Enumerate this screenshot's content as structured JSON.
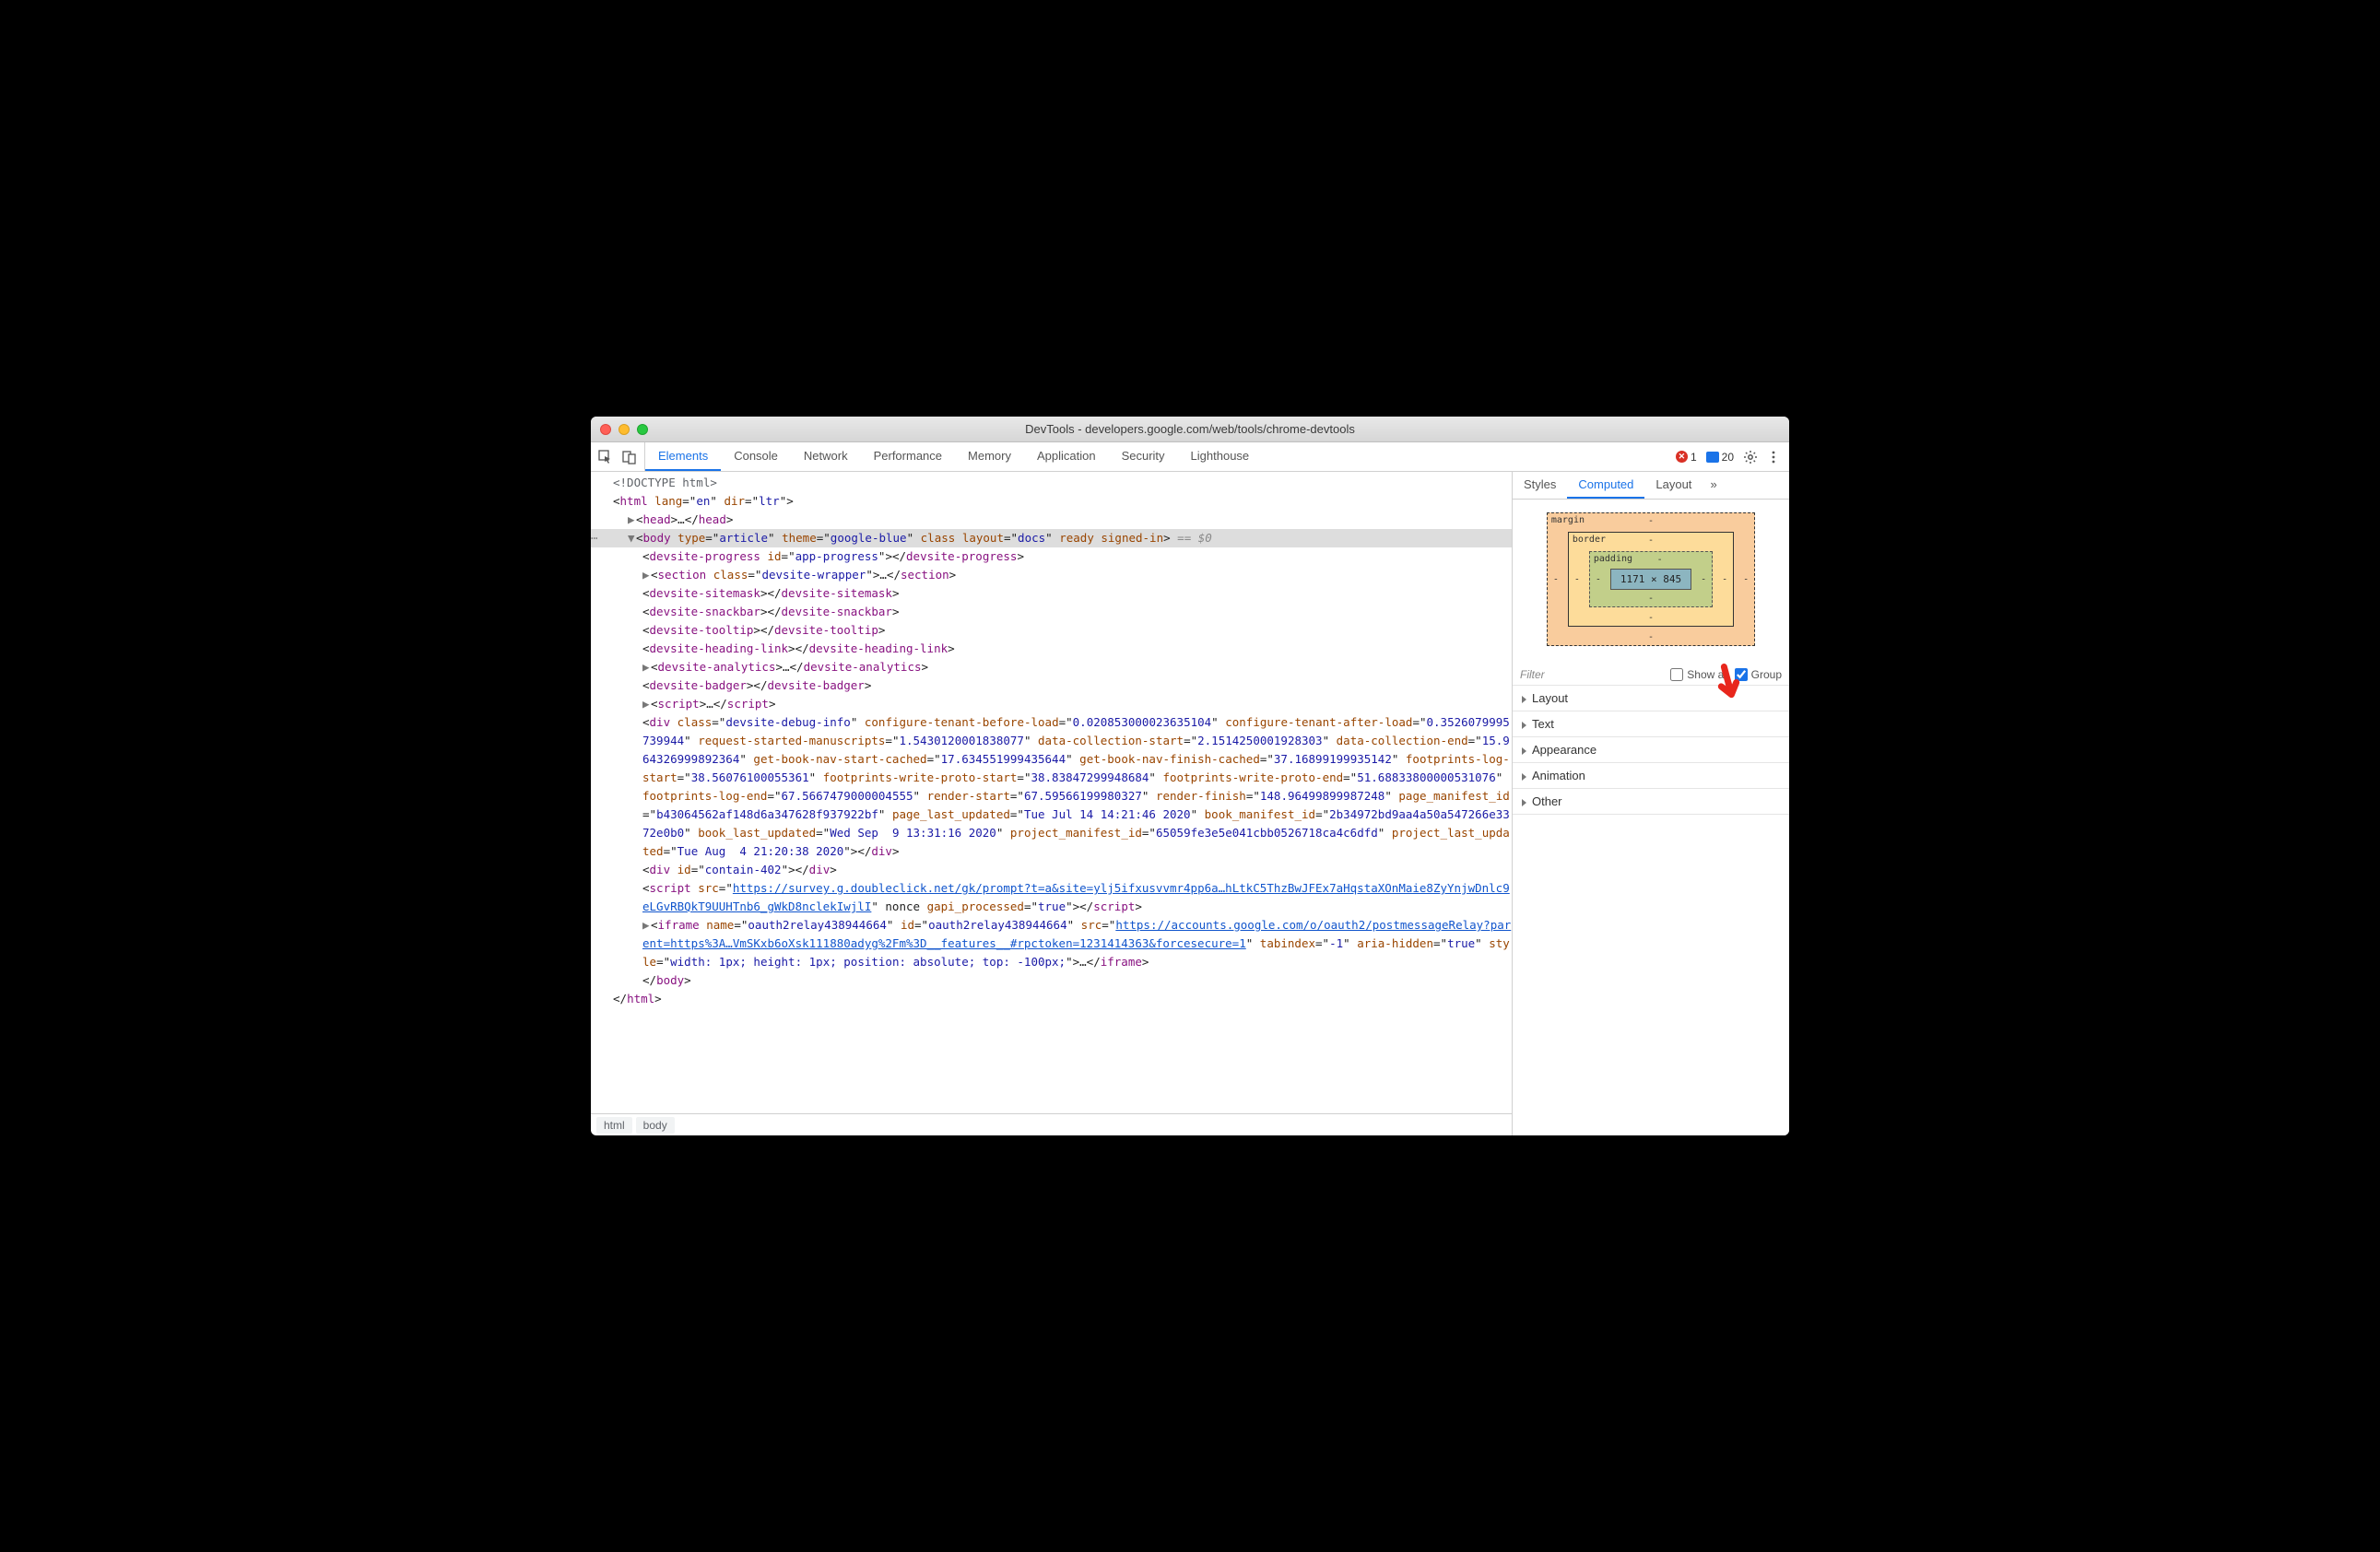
{
  "window": {
    "title": "DevTools - developers.google.com/web/tools/chrome-devtools"
  },
  "toolbar": {
    "tabs": [
      "Elements",
      "Console",
      "Network",
      "Performance",
      "Memory",
      "Application",
      "Security",
      "Lighthouse"
    ],
    "active_tab": "Elements",
    "errors": "1",
    "messages": "20"
  },
  "side": {
    "tabs": [
      "Styles",
      "Computed",
      "Layout"
    ],
    "active_tab": "Computed",
    "box_model": {
      "margin_label": "margin",
      "border_label": "border",
      "padding_label": "padding",
      "content_size": "1171 × 845",
      "dash": "-"
    },
    "filter_placeholder": "Filter",
    "show_all_label": "Show all",
    "show_all_checked": false,
    "group_label": "Group",
    "group_checked": true,
    "sections": [
      "Layout",
      "Text",
      "Appearance",
      "Animation",
      "Other"
    ]
  },
  "breadcrumbs": [
    "html",
    "body"
  ],
  "dom": {
    "doctype": "<!DOCTYPE html>",
    "html_open_tag": "html",
    "html_attrs": [
      [
        "lang",
        "en"
      ],
      [
        "dir",
        "ltr"
      ]
    ],
    "head_tag": "head",
    "ellipsis": "…",
    "body_tag": "body",
    "body_attrs": [
      [
        "type",
        "article"
      ],
      [
        "theme",
        "google-blue"
      ]
    ],
    "body_class_word": "class",
    "body_layout_attr": [
      "layout",
      "docs"
    ],
    "body_trailing_attrs": "ready signed-in",
    "body_dim": "== $0",
    "children": [
      {
        "open": "devsite-progress",
        "attrs": [
          [
            "id",
            "app-progress"
          ]
        ],
        "close": "devsite-progress"
      },
      {
        "caret": true,
        "open": "section",
        "attrs": [
          [
            "class",
            "devsite-wrapper"
          ]
        ],
        "ell": true,
        "close": "section"
      },
      {
        "open": "devsite-sitemask",
        "close": "devsite-sitemask"
      },
      {
        "open": "devsite-snackbar",
        "close": "devsite-snackbar"
      },
      {
        "open": "devsite-tooltip",
        "close": "devsite-tooltip"
      },
      {
        "open": "devsite-heading-link",
        "close": "devsite-heading-link"
      },
      {
        "caret": true,
        "open": "devsite-analytics",
        "ell": true,
        "close": "devsite-analytics"
      },
      {
        "open": "devsite-badger",
        "close": "devsite-badger"
      },
      {
        "caret": true,
        "open": "script",
        "ell": true,
        "close": "script"
      }
    ],
    "big_div": {
      "tag": "div",
      "attrs_flow": "class=\"devsite-debug-info\" configure-tenant-before-load=\"0.020853000023635104\" configure-tenant-after-load=\"0.3526079995739944\" request-started-manuscripts=\"1.5430120001838077\" data-collection-start=\"2.1514250001928303\" data-collection-end=\"15.964326999892364\" get-book-nav-start-cached=\"17.634551999435644\" get-book-nav-finish-cached=\"37.16899199935142\" footprints-log-start=\"38.56076100055361\" footprints-write-proto-start=\"38.83847299948684\" footprints-write-proto-end=\"51.68833800000531076\" footprints-log-end=\"67.5667479000004555\" render-start=\"67.59566199980327\" render-finish=\"148.96499899987248\" page_manifest_id=\"b43064562af148d6a347628f937922bf\" page_last_updated=\"Tue Jul 14 14:21:46 2020\" book_manifest_id=\"2b34972bd9aa4a50a547266e3372e0b0\" book_last_updated=\"Wed Sep  9 13:31:16 2020\" project_manifest_id=\"65059fe3e5e041cbb0526718ca4c6dfd\" project_last_updated=\"Tue Aug  4 21:20:38 2020\"",
      "close": "div"
    },
    "contain_div": {
      "tag": "div",
      "attrs": [
        [
          "id",
          "contain-402"
        ]
      ],
      "close": "div"
    },
    "script_src": {
      "tag": "script",
      "src": "https://survey.g.doubleclick.net/gk/prompt?t=a&site=ylj5ifxusvvmr4pp6a…hLtkC5ThzBwJFEx7aHqstaXOnMaie8ZyYnjwDnlc9eLGvRBQkT9UUHTnb6_gWkD8nclekIwjlI",
      "trailing": " nonce gapi_processed=\"true\"",
      "close": "script"
    },
    "iframe": {
      "tag": "iframe",
      "pre_attrs": [
        [
          "name",
          "oauth2relay438944664"
        ],
        [
          "id",
          "oauth2relay438944664"
        ]
      ],
      "src": "https://accounts.google.com/o/oauth2/postmessageRelay?parent=https%3A…VmSKxb6oXsk111880adyg%2Fm%3D__features__#rpctoken=1231414363&forcesecure=1",
      "post": " tabindex=\"-1\" aria-hidden=\"true\" style=\"width: 1px; height: 1px; position: absolute; top: -100px;\"",
      "ell": true,
      "close": "iframe"
    },
    "body_close": "body",
    "html_close": "html"
  }
}
